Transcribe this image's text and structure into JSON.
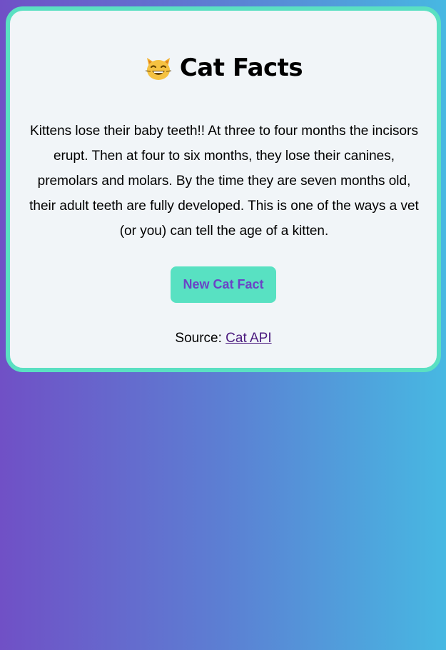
{
  "header": {
    "title": "Cat Facts",
    "icon": "grinning-cat-face-icon"
  },
  "fact": {
    "text": "Kittens lose their baby teeth!! At three to four months the incisors erupt. Then at four to six months, they lose their canines, premolars and molars. By the time they are seven months old, their adult teeth are fully developed. This is one of the ways a vet (or you) can tell the age of a kitten."
  },
  "button": {
    "label": "New Cat Fact"
  },
  "source": {
    "prefix": "Source: ",
    "link_text": "Cat API"
  },
  "colors": {
    "card_border": "#5ae0c2",
    "button_bg": "#58e1c2",
    "button_text": "#6b43c6",
    "link": "#4b1a7e",
    "background_start": "#7050c6",
    "background_end": "#47b8e2"
  }
}
